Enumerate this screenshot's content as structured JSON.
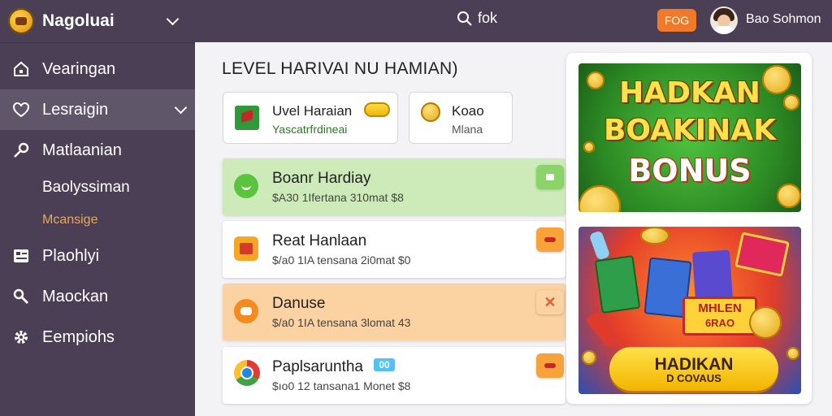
{
  "brand": {
    "title": "Nagoluai"
  },
  "sidebar": {
    "items": [
      {
        "label": "Vearingan",
        "icon": "home-icon"
      },
      {
        "label": "Lesraigin",
        "icon": "heart-icon"
      },
      {
        "label": "Matlaanian",
        "icon": "key-icon"
      },
      {
        "label": "Baolyssiman"
      },
      {
        "label": "Mcansige"
      },
      {
        "label": "Plaohlyi",
        "icon": "list-icon"
      },
      {
        "label": "Maockan",
        "icon": "link-icon"
      },
      {
        "label": "Eempiohs",
        "icon": "gear-icon"
      }
    ]
  },
  "topbar": {
    "search_text": "fok",
    "badge": "FOG",
    "username": "Bao Sohmon"
  },
  "page": {
    "title": "LEVEL HARIVAI NU HAMIAN)"
  },
  "cards": [
    {
      "title": "Uvel Haraian",
      "subtitle": "Yascatrfrdineai",
      "icon": "flag-icon"
    },
    {
      "title": "Koao",
      "subtitle": "Mlana",
      "icon": "coin-icon"
    }
  ],
  "rows": [
    {
      "title": "Boanr Hardiay",
      "subtitle": "$A30 1Ifertana 310mat $8",
      "bg": "#cdebb8"
    },
    {
      "title": "Reat Hanlaan",
      "subtitle": "$/a0 1IA tensana 2i0mat $0",
      "bg": "#ffffff"
    },
    {
      "title": "Danuse",
      "subtitle": "$/a0 1IA tensana 3lomat 43",
      "bg": "#fbd2a2"
    },
    {
      "title": "Paplsaruntha",
      "subtitle": "$ıo0 12 tansana1 Monet $8",
      "badge": "00",
      "bg": "#ffffff"
    }
  ],
  "promo": {
    "banner1": {
      "line1": "HADKAN",
      "line2": "BOAKINAK",
      "line3": "BONUS"
    },
    "banner2": {
      "sign_top": "MHLEN",
      "sign_bottom": "6RAO",
      "cta_line1": "HADIKAN",
      "cta_line2": "D COVAUS"
    }
  }
}
